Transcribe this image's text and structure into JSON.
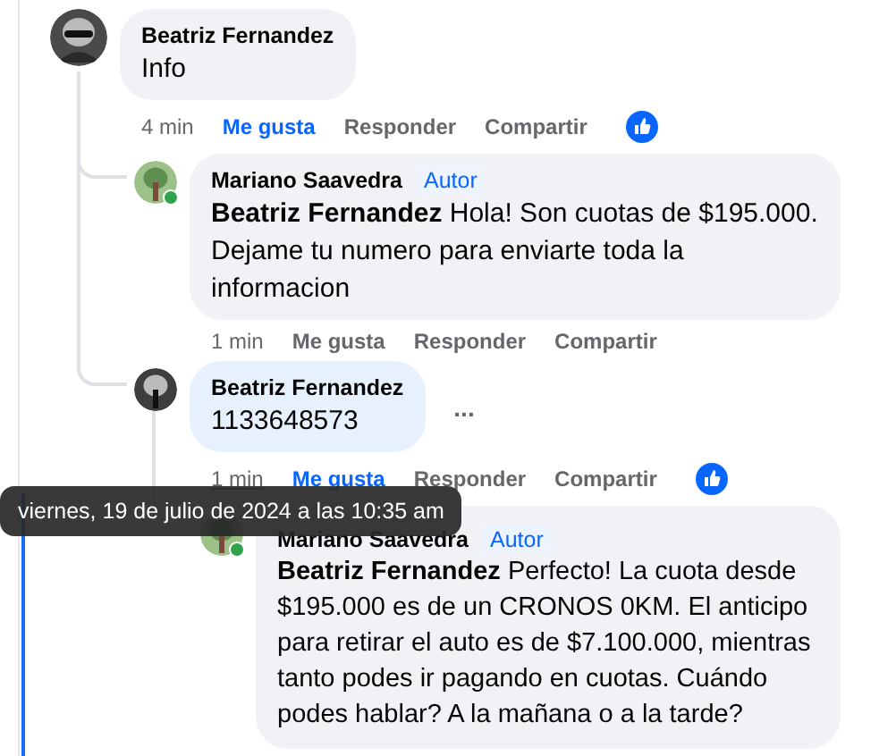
{
  "comments": [
    {
      "author": "Beatriz Fernandez",
      "text": "Info",
      "time": "4 min",
      "liked": true,
      "time_hovered": false,
      "has_reaction": true,
      "online": false,
      "actions": [
        "Me gusta",
        "Responder",
        "Compartir"
      ],
      "replies": [
        {
          "author": "Mariano Saavedra",
          "badge": "Autor",
          "mention": "Beatriz Fernandez",
          "text": "Hola! Son cuotas de $195.000. Dejame tu numero para enviarte toda la informacion",
          "time": "1 min",
          "liked": false,
          "time_hovered": false,
          "has_reaction": false,
          "online": true,
          "actions": [
            "Me gusta",
            "Responder",
            "Compartir"
          ]
        },
        {
          "author": "Beatriz Fernandez",
          "text": "1133648573",
          "time": "1 min",
          "liked": true,
          "time_hovered": true,
          "has_reaction": true,
          "online": false,
          "menu_label": "...",
          "actions": [
            "Me gusta",
            "Responder",
            "Compartir"
          ],
          "replies": [
            {
              "author": "Mariano Saavedra",
              "badge": "Autor",
              "mention": "Beatriz Fernandez",
              "text": "Perfecto! La cuota desde $195.000 es de un CRONOS 0KM. El anticipo para retirar el auto es de $7.100.000, mientras tanto podes ir pagando en cuotas. Cuándo podes hablar? A la mañana o a la tarde?",
              "online": true
            }
          ]
        }
      ]
    }
  ],
  "tooltip": "viernes, 19 de julio de 2024 a las 10:35 am"
}
